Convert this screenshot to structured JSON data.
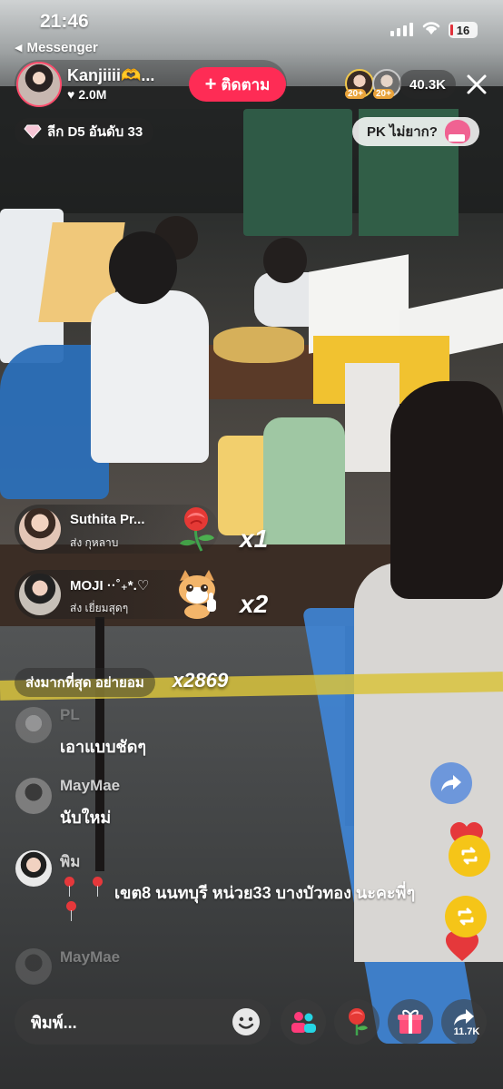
{
  "status_bar": {
    "time": "21:46",
    "back_app": "Messenger",
    "battery": "16"
  },
  "host": {
    "name": "Kanjiiii🫶...",
    "likes": "2.0M",
    "follow_label": "ติดตาม"
  },
  "viewers": {
    "badge1": "20+",
    "badge2": "20+",
    "count": "40.3K"
  },
  "league": {
    "label": "ลีก D5 อันดับ 33"
  },
  "pk": {
    "label": "PK ไม่ยาก?"
  },
  "gifts": [
    {
      "name": "Suthita Pr...",
      "action": "ส่ง กุหลาบ",
      "combo": "x1",
      "gift_icon": "rose-icon"
    },
    {
      "name": "MOJI ··˚₊*.♡",
      "action": "ส่ง เยี่ยมสุดๆ",
      "combo": "x2",
      "gift_icon": "cat-thumbs-up-icon"
    }
  ],
  "top_gift": {
    "label": "ส่งมากที่สุด อย่ายอม",
    "count": "x2869"
  },
  "chat": [
    {
      "name": "PL",
      "text": "เอาแบบชัดๆ"
    },
    {
      "name": "MayMae",
      "text": "นับใหม่"
    },
    {
      "name": "พิม",
      "text": "เขต8 นนทบุรี หน่วย33 บางบัวทอง นะคะพี่ๆ"
    },
    {
      "name": "MayMae",
      "text": ""
    }
  ],
  "bottom_bar": {
    "placeholder": "พิมพ์...",
    "share_count": "11.7K"
  },
  "colors": {
    "follow": "#fe2c55",
    "repost": "#f5c518",
    "heart": "#e5383b"
  }
}
